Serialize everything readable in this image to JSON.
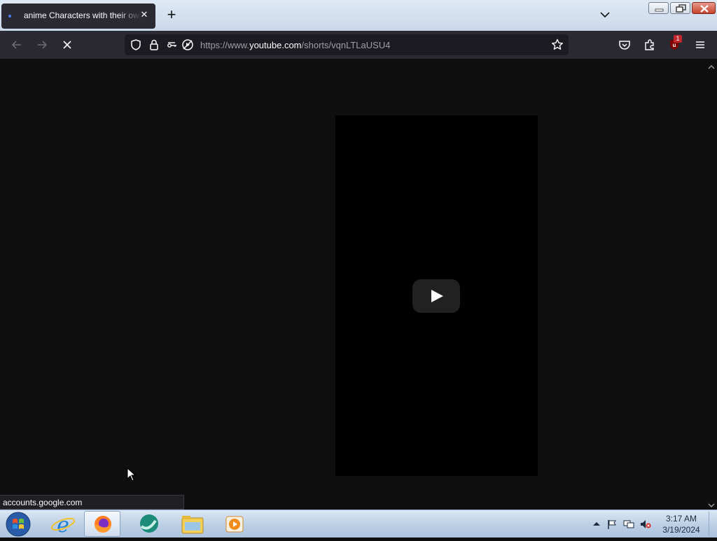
{
  "browser": {
    "tab": {
      "title": "anime Characters with their own"
    },
    "url": {
      "scheme": "https://www.",
      "host": "youtube.com",
      "path": "/shorts/vqnLTLaUSU4"
    },
    "extension_badge": "1"
  },
  "status_bar": {
    "text": "accounts.google.com"
  },
  "taskbar": {
    "clock": {
      "time": "3:17 AM",
      "date": "3/19/2024"
    }
  },
  "colors": {
    "page_bg": "#0f0f0f",
    "player_bg": "#000000",
    "toolbar": "#2b2a33",
    "accent_badge": "#c0272d"
  }
}
